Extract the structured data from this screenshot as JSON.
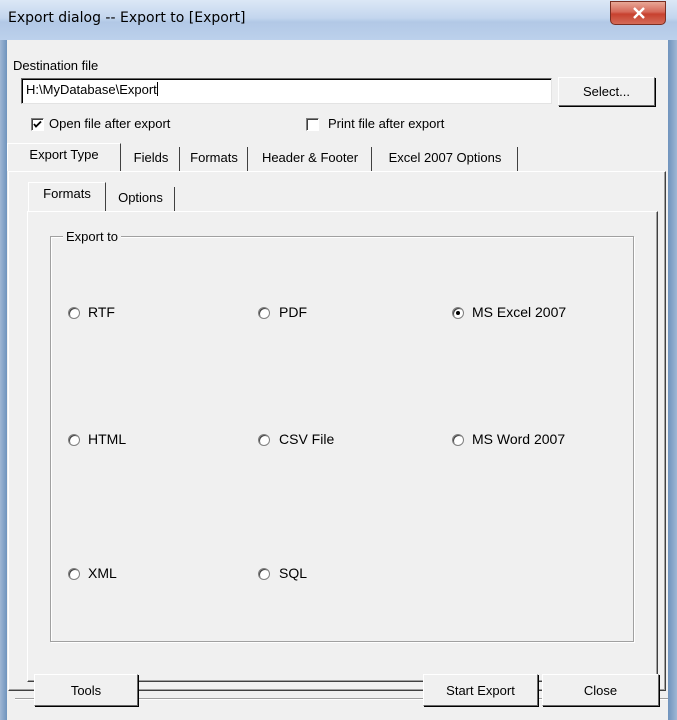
{
  "window": {
    "title": "Export dialog -- Export to [Export]"
  },
  "destination": {
    "label": "Destination file",
    "value": "H:\\MyDatabase\\Export",
    "select_label": "Select..."
  },
  "options": {
    "open_after": {
      "label": "Open file after export",
      "checked": true
    },
    "print_after": {
      "label": "Print file after export",
      "checked": false
    }
  },
  "main_tabs": [
    {
      "label": "Export Type",
      "active": true
    },
    {
      "label": "Fields",
      "active": false
    },
    {
      "label": "Formats",
      "active": false
    },
    {
      "label": "Header & Footer",
      "active": false
    },
    {
      "label": "Excel 2007 Options",
      "active": false
    }
  ],
  "sub_tabs": [
    {
      "label": "Formats",
      "active": true
    },
    {
      "label": "Options",
      "active": false
    }
  ],
  "export_group": {
    "title": "Export to",
    "formats": [
      {
        "label": "RTF",
        "selected": false
      },
      {
        "label": "PDF",
        "selected": false
      },
      {
        "label": "MS Excel 2007",
        "selected": true
      },
      {
        "label": "HTML",
        "selected": false
      },
      {
        "label": "CSV File",
        "selected": false
      },
      {
        "label": "MS Word 2007",
        "selected": false
      },
      {
        "label": "XML",
        "selected": false
      },
      {
        "label": "SQL",
        "selected": false
      }
    ]
  },
  "footer": {
    "tools_label": "Tools",
    "start_label": "Start Export",
    "close_label": "Close"
  },
  "colors": {
    "close_button": "#c7412f",
    "titlebar": "#c3d6ee"
  }
}
